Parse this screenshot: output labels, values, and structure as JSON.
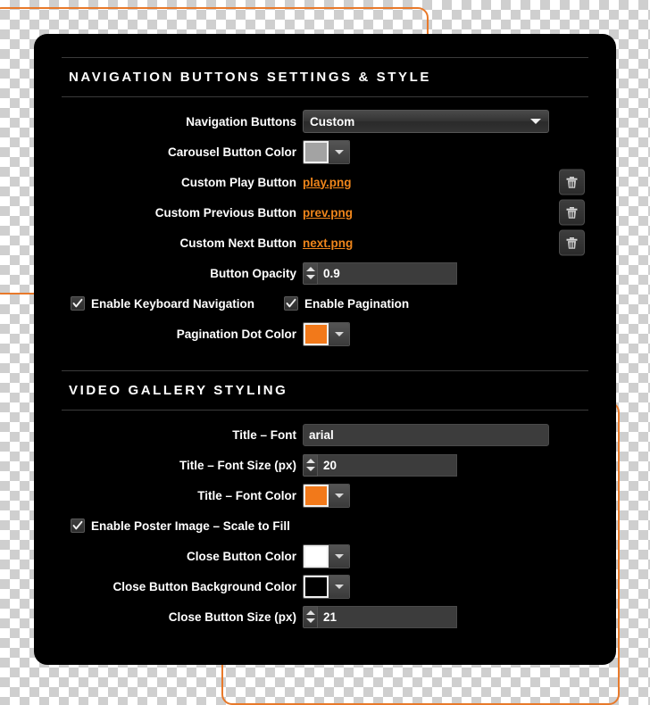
{
  "decorations": {
    "accent_color": "#e8792a"
  },
  "panel": {
    "background_color": "#000000",
    "sections": [
      {
        "title": "NAVIGATION BUTTONS SETTINGS & STYLE",
        "rows": [
          {
            "type": "select",
            "label": "Navigation Buttons",
            "value": "Custom",
            "icon": "chevron-down-icon"
          },
          {
            "type": "color",
            "label": "Carousel Button Color",
            "value": "#a3a3a3",
            "icon": "chevron-down-icon"
          },
          {
            "type": "file",
            "label": "Custom Play Button",
            "value": "play.png",
            "link_color": "#f0861b",
            "action_icon": "trash-icon"
          },
          {
            "type": "file",
            "label": "Custom Previous Button",
            "value": "prev.png",
            "link_color": "#f0861b",
            "action_icon": "trash-icon"
          },
          {
            "type": "file",
            "label": "Custom Next Button",
            "value": "next.png",
            "link_color": "#f0861b",
            "action_icon": "trash-icon"
          },
          {
            "type": "number",
            "label": "Button Opacity",
            "value": "0.9",
            "icon": "spinner-icon"
          },
          {
            "type": "checkboxes",
            "items": [
              {
                "label": "Enable Keyboard Navigation",
                "checked": true
              },
              {
                "label": "Enable Pagination",
                "checked": true
              }
            ]
          },
          {
            "type": "color",
            "label": "Pagination Dot Color",
            "value": "#f2791a",
            "icon": "chevron-down-icon"
          }
        ]
      },
      {
        "title": "VIDEO GALLERY STYLING",
        "rows": [
          {
            "type": "text",
            "label": "Title – Font",
            "value": "arial"
          },
          {
            "type": "number",
            "label": "Title – Font Size (px)",
            "value": "20",
            "icon": "spinner-icon"
          },
          {
            "type": "color",
            "label": "Title – Font Color",
            "value": "#f2791a",
            "icon": "chevron-down-icon"
          },
          {
            "type": "checkboxes",
            "items": [
              {
                "label": "Enable Poster Image – Scale to Fill",
                "checked": true
              }
            ]
          },
          {
            "type": "color",
            "label": "Close Button Color",
            "value": "#ffffff",
            "icon": "chevron-down-icon"
          },
          {
            "type": "color",
            "label": "Close Button Background Color",
            "value": "#000000",
            "icon": "chevron-down-icon"
          },
          {
            "type": "number",
            "label": "Close Button Size (px)",
            "value": "21",
            "icon": "spinner-icon"
          }
        ]
      }
    ]
  }
}
